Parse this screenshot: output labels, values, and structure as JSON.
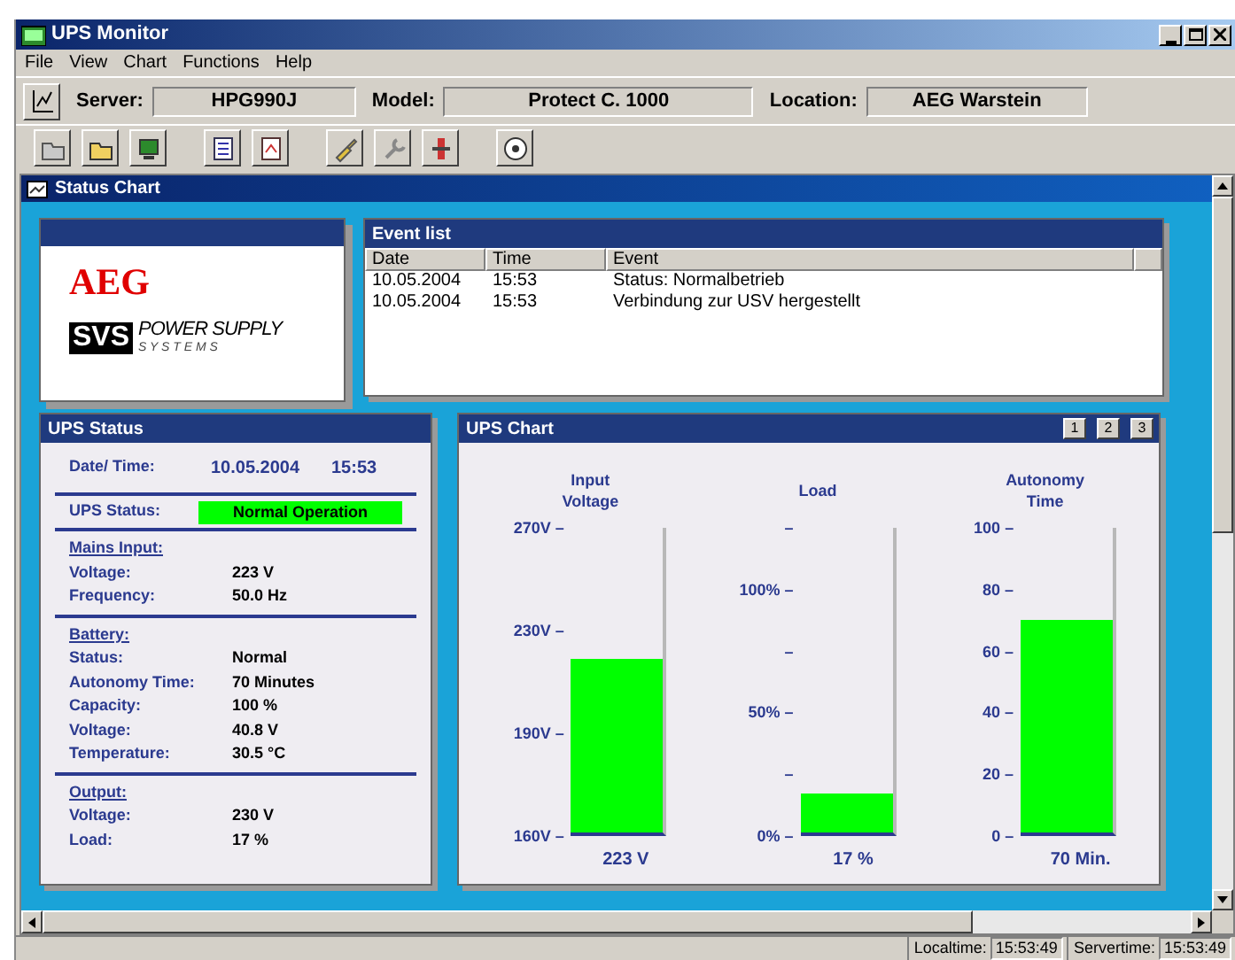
{
  "window": {
    "title": "UPS Monitor"
  },
  "menu": [
    "File",
    "View",
    "Chart",
    "Functions",
    "Help"
  ],
  "server_bar": {
    "fields": [
      {
        "label": "Server:",
        "value": "HPG990J"
      },
      {
        "label": "Model:",
        "value": "Protect C. 1000"
      },
      {
        "label": "Location:",
        "value": "AEG Warstein"
      }
    ]
  },
  "child_window": {
    "title": "Status Chart"
  },
  "logo": {
    "brand": "AEG",
    "mark": "SVS",
    "line1": "POWER SUPPLY",
    "line2": "S Y S T E M S"
  },
  "event_list": {
    "title": "Event list",
    "columns": [
      "Date",
      "Time",
      "Event"
    ],
    "rows": [
      {
        "date": "10.05.2004",
        "time": "15:53",
        "event": "Status: Normalbetrieb"
      },
      {
        "date": "10.05.2004",
        "time": "15:53",
        "event": "Verbindung zur USV hergestellt"
      }
    ]
  },
  "ups_status": {
    "title": "UPS Status",
    "date_time": {
      "label": "Date/ Time:",
      "date": "10.05.2004",
      "time": "15:53"
    },
    "status": {
      "label": "UPS Status:",
      "value": "Normal Operation"
    },
    "sections": [
      {
        "heading": "Mains Input:",
        "rows": [
          {
            "label": "Voltage:",
            "value": "223 V"
          },
          {
            "label": "Frequency:",
            "value": "50.0 Hz"
          }
        ]
      },
      {
        "heading": "Battery:",
        "rows": [
          {
            "label": "Status:",
            "value": "Normal"
          },
          {
            "label": "Autonomy Time:",
            "value": "70 Minutes"
          },
          {
            "label": "Capacity:",
            "value": "100 %"
          },
          {
            "label": "Voltage:",
            "value": "40.8 V"
          },
          {
            "label": "Temperature:",
            "value": "30.5 °C"
          }
        ]
      },
      {
        "heading": "Output:",
        "rows": [
          {
            "label": "Voltage:",
            "value": "230 V"
          },
          {
            "label": "Load:",
            "value": "17 %"
          }
        ]
      }
    ]
  },
  "ups_chart": {
    "title": "UPS Chart",
    "view_buttons": [
      "1",
      "2",
      "3"
    ],
    "gauges": [
      {
        "title": "Input Voltage",
        "ticks": [
          "270V –",
          "230V –",
          "190V –",
          "160V –"
        ],
        "level": 0.57,
        "reading": "223 V"
      },
      {
        "title": "Load",
        "ticks": [
          "–",
          "100% –",
          "–",
          "50% –",
          "–",
          "0% –"
        ],
        "level": 0.13,
        "reading": "17 %"
      },
      {
        "title": "Autonomy Time",
        "ticks": [
          "100 –",
          "80 –",
          "60 –",
          "40 –",
          "20 –",
          "0 –"
        ],
        "level": 0.7,
        "reading": "70 Min."
      }
    ]
  },
  "status_bar": {
    "items": [
      {
        "label": "Localtime:",
        "value": "15:53:49"
      },
      {
        "label": "Servertime:",
        "value": "15:53:49"
      }
    ]
  }
}
